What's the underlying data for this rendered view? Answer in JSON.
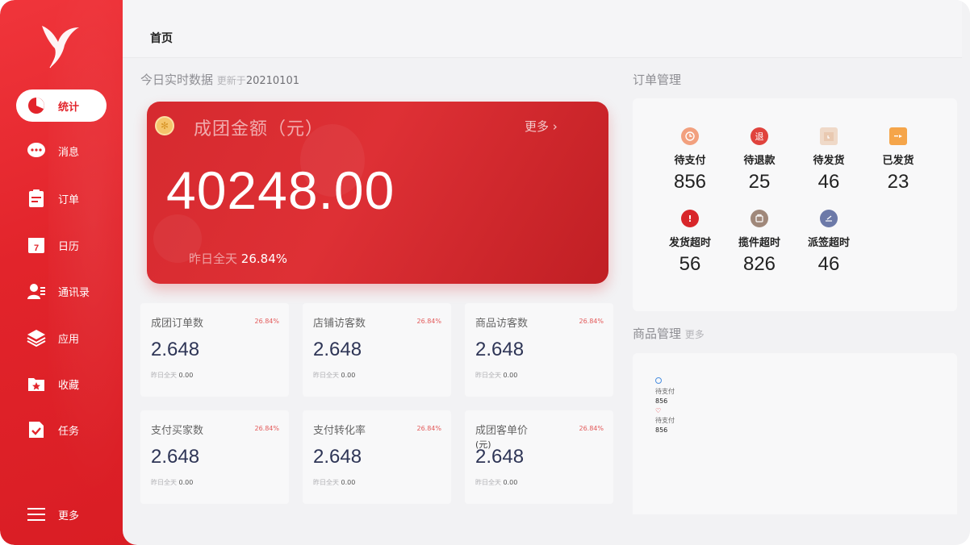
{
  "sidebar": {
    "items": [
      {
        "label": "统计",
        "icon": "pie-chart-icon"
      },
      {
        "label": "消息",
        "icon": "chat-bubble-icon"
      },
      {
        "label": "订单",
        "icon": "clipboard-icon"
      },
      {
        "label": "日历",
        "icon": "calendar-icon",
        "day": "7"
      },
      {
        "label": "通讯录",
        "icon": "contacts-icon"
      },
      {
        "label": "应用",
        "icon": "layers-icon"
      },
      {
        "label": "收藏",
        "icon": "favorite-folder-icon"
      },
      {
        "label": "任务",
        "icon": "task-check-icon"
      }
    ],
    "more_label": "更多"
  },
  "header": {
    "title": "首页"
  },
  "realtime": {
    "title": "今日实时数据",
    "updated_label": "更新于",
    "updated_date": "20210101"
  },
  "hero": {
    "title": "成团金额（元）",
    "more": "更多",
    "amount": "40248.00",
    "yday_label": "昨日全天",
    "yday_pct": "26.84%"
  },
  "stats": [
    {
      "name": "成团订单数",
      "pct": "26.84%",
      "value": "2.648",
      "yday_label": "昨日全天",
      "yday_value": "0.00"
    },
    {
      "name": "店铺访客数",
      "pct": "26.84%",
      "value": "2.648",
      "yday_label": "昨日全天",
      "yday_value": "0.00"
    },
    {
      "name": "商品访客数",
      "pct": "26.84%",
      "value": "2.648",
      "yday_label": "昨日全天",
      "yday_value": "0.00"
    },
    {
      "name": "支付买家数",
      "pct": "26.84%",
      "value": "2.648",
      "yday_label": "昨日全天",
      "yday_value": "0.00"
    },
    {
      "name": "支付转化率",
      "pct": "26.84%",
      "value": "2.648",
      "yday_label": "昨日全天",
      "yday_value": "0.00"
    },
    {
      "name": "成团客单价",
      "unit": "(元)",
      "pct": "26.84%",
      "value": "2.648",
      "yday_label": "昨日全天",
      "yday_value": "0.00"
    }
  ],
  "orders": {
    "title": "订单管理",
    "items": [
      {
        "label": "待支付",
        "value": "856",
        "color": "#f2a07e",
        "icon": "clock-icon"
      },
      {
        "label": "待退款",
        "value": "25",
        "color": "#e0433d",
        "icon": "refund-icon",
        "glyph": "退"
      },
      {
        "label": "待发货",
        "value": "46",
        "color": "#efd9c8",
        "icon": "box-clock-icon"
      },
      {
        "label": "已发货",
        "value": "23",
        "color": "#f5a54a",
        "icon": "shipped-icon"
      },
      {
        "label": "发货超时",
        "value": "56",
        "color": "#d8262a",
        "icon": "alert-icon",
        "glyph": "!"
      },
      {
        "label": "揽件超时",
        "value": "826",
        "color": "#a0887a",
        "icon": "parcel-icon"
      },
      {
        "label": "派签超时",
        "value": "46",
        "color": "#6c79a8",
        "icon": "sign-icon"
      }
    ]
  },
  "products": {
    "title": "商品管理",
    "more": "更多",
    "items": [
      {
        "label": "待支付",
        "value": "856",
        "icon": "smile-icon"
      },
      {
        "label": "待支付",
        "value": "856",
        "icon": "heart-icon"
      }
    ]
  }
}
